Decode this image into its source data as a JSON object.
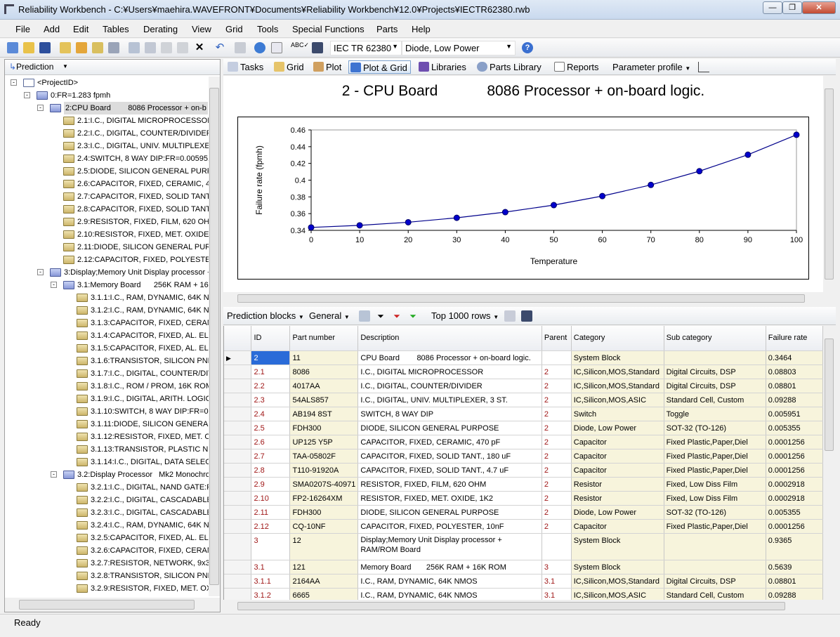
{
  "window": {
    "title": "Reliability Workbench - C:¥Users¥maehira.WAVEFRONT¥Documents¥Reliability Workbench¥12.0¥Projects¥IECTR62380.rwb"
  },
  "menu": [
    "File",
    "Add",
    "Edit",
    "Tables",
    "Derating",
    "View",
    "Grid",
    "Tools",
    "Special Functions",
    "Parts",
    "Help"
  ],
  "toolbar": {
    "standard_combo": "IEC TR 62380",
    "category_combo": "Diode, Low Power"
  },
  "left_header": "Prediction",
  "tree": [
    {
      "label": "<ProjectID>",
      "depth": 0,
      "exp": "-",
      "icon": "doc"
    },
    {
      "label": "0:FR=1.283 fpmh",
      "depth": 1,
      "exp": "-",
      "icon": "blue"
    },
    {
      "label": "2:CPU Board        8086 Processor + on-b",
      "depth": 2,
      "exp": "-",
      "icon": "blue",
      "hl": true
    },
    {
      "label": "2.1:I.C., DIGITAL MICROPROCESSOR:F",
      "depth": 3,
      "icon": "y"
    },
    {
      "label": "2.2:I.C., DIGITAL, COUNTER/DIVIDER:F",
      "depth": 3,
      "icon": "y"
    },
    {
      "label": "2.3:I.C., DIGITAL, UNIV. MULTIPLEXER, ",
      "depth": 3,
      "icon": "y"
    },
    {
      "label": "2.4:SWITCH, 8 WAY DIP:FR=0.005951",
      "depth": 3,
      "icon": "y"
    },
    {
      "label": "2.5:DIODE, SILICON GENERAL PURPOS",
      "depth": 3,
      "icon": "y"
    },
    {
      "label": "2.6:CAPACITOR, FIXED, CERAMIC, 470",
      "depth": 3,
      "icon": "y"
    },
    {
      "label": "2.7:CAPACITOR, FIXED, SOLID TANT., ",
      "depth": 3,
      "icon": "y"
    },
    {
      "label": "2.8:CAPACITOR, FIXED, SOLID TANT., ",
      "depth": 3,
      "icon": "y"
    },
    {
      "label": "2.9:RESISTOR, FIXED, FILM, 620 OHM:I",
      "depth": 3,
      "icon": "y"
    },
    {
      "label": "2.10:RESISTOR, FIXED, MET. OXIDE, 1I",
      "depth": 3,
      "icon": "y"
    },
    {
      "label": "2.11:DIODE, SILICON GENERAL PURPO",
      "depth": 3,
      "icon": "y"
    },
    {
      "label": "2.12:CAPACITOR, FIXED, POLYESTER, ",
      "depth": 3,
      "icon": "y"
    },
    {
      "label": "3:Display;Memory Unit Display processor +",
      "depth": 2,
      "exp": "-",
      "icon": "blue"
    },
    {
      "label": "3.1:Memory Board      256K RAM + 16",
      "depth": 3,
      "exp": "-",
      "icon": "blue"
    },
    {
      "label": "3.1.1:I.C., RAM, DYNAMIC, 64K NM",
      "depth": 4,
      "icon": "y"
    },
    {
      "label": "3.1.2:I.C., RAM, DYNAMIC, 64K NM",
      "depth": 4,
      "icon": "y"
    },
    {
      "label": "3.1.3:CAPACITOR, FIXED, CERAMI",
      "depth": 4,
      "icon": "y"
    },
    {
      "label": "3.1.4:CAPACITOR, FIXED, AL. ELE",
      "depth": 4,
      "icon": "y"
    },
    {
      "label": "3.1.5:CAPACITOR, FIXED, AL. ELE",
      "depth": 4,
      "icon": "y"
    },
    {
      "label": "3.1.6:TRANSISTOR, SILICON PNP:F",
      "depth": 4,
      "icon": "y"
    },
    {
      "label": "3.1.7:I.C., DIGITAL, COUNTER/DIVI",
      "depth": 4,
      "icon": "y"
    },
    {
      "label": "3.1.8:I.C., ROM / PROM, 16K ROM:F",
      "depth": 4,
      "icon": "y"
    },
    {
      "label": "3.1.9:I.C., DIGITAL, ARITH. LOGIC/",
      "depth": 4,
      "icon": "y"
    },
    {
      "label": "3.1.10:SWITCH, 8 WAY DIP:FR=0.0",
      "depth": 4,
      "icon": "y"
    },
    {
      "label": "3.1.11:DIODE, SILICON GENERAL F",
      "depth": 4,
      "icon": "y"
    },
    {
      "label": "3.1.12:RESISTOR, FIXED, MET. OXI",
      "depth": 4,
      "icon": "y"
    },
    {
      "label": "3.1.13:TRANSISTOR, PLASTIC NPN",
      "depth": 4,
      "icon": "y"
    },
    {
      "label": "3.1.14:I.C., DIGITAL, DATA SELECT",
      "depth": 4,
      "icon": "y"
    },
    {
      "label": "3.2:Display Processor   Mk2 Monochro",
      "depth": 3,
      "exp": "-",
      "icon": "blue"
    },
    {
      "label": "3.2.1:I.C., DIGITAL, NAND GATE:FF",
      "depth": 4,
      "icon": "y"
    },
    {
      "label": "3.2.2:I.C., DIGITAL, CASCADABLE",
      "depth": 4,
      "icon": "y"
    },
    {
      "label": "3.2.3:I.C., DIGITAL, CASCADABLE",
      "depth": 4,
      "icon": "y"
    },
    {
      "label": "3.2.4:I.C., RAM, DYNAMIC, 64K NM",
      "depth": 4,
      "icon": "y"
    },
    {
      "label": "3.2.5:CAPACITOR, FIXED, AL. ELE",
      "depth": 4,
      "icon": "y"
    },
    {
      "label": "3.2.6:CAPACITOR, FIXED, CERAMI",
      "depth": 4,
      "icon": "y"
    },
    {
      "label": "3.2.7:RESISTOR, NETWORK, 9x33(",
      "depth": 4,
      "icon": "y"
    },
    {
      "label": "3.2.8:TRANSISTOR, SILICON PNP:F",
      "depth": 4,
      "icon": "y"
    },
    {
      "label": "3.2.9:RESISTOR, FIXED, MET. OXID",
      "depth": 4,
      "icon": "y"
    }
  ],
  "tabs": [
    "Tasks",
    "Grid",
    "Plot",
    "Plot & Grid",
    "Libraries",
    "Parts Library",
    "Reports",
    "Parameter profile"
  ],
  "chart_title": "2 - CPU Board            8086 Processor + on-board logic.",
  "chart_data": {
    "type": "line",
    "x": [
      0,
      10,
      20,
      30,
      40,
      50,
      60,
      70,
      80,
      90,
      100
    ],
    "series": [
      {
        "values": [
          0.3435,
          0.346,
          0.3497,
          0.355,
          0.3618,
          0.3702,
          0.381,
          0.3943,
          0.4107,
          0.4304,
          0.4542
        ]
      }
    ],
    "xlabel": "Temperature",
    "ylabel": "Failure rate (fpmh)",
    "xlim": [
      0,
      100
    ],
    "ylim": [
      0.34,
      0.46
    ],
    "xticks": [
      0,
      10,
      20,
      30,
      40,
      50,
      60,
      70,
      80,
      90,
      100
    ],
    "yticks": [
      0.34,
      0.36,
      0.38,
      0.4,
      0.42,
      0.44,
      0.46
    ],
    "ytick_labels": [
      "0.34",
      "0.36",
      "0.38",
      "0.4",
      "0.42",
      "0.44",
      "0.46"
    ],
    "line_color": "#00008b",
    "marker_color": "#0000cc"
  },
  "grid_toolbar": {
    "blocks": "Prediction blocks",
    "view": "General",
    "rows": "Top 1000 rows"
  },
  "columns": [
    "ID",
    "Part number",
    "Description",
    "Parent",
    "Category",
    "Sub category",
    "Failure rate"
  ],
  "rows": [
    [
      "2",
      "11",
      "CPU Board        8086 Processor + on-board logic.",
      "",
      "System Block",
      "",
      "0.3464"
    ],
    [
      "2.1",
      "8086",
      "I.C., DIGITAL MICROPROCESSOR",
      "2",
      "IC,Silicon,MOS,Standard",
      "Digital Circuits, DSP",
      "0.08803"
    ],
    [
      "2.2",
      "4017AA",
      "I.C., DIGITAL, COUNTER/DIVIDER",
      "2",
      "IC,Silicon,MOS,Standard",
      "Digital Circuits, DSP",
      "0.08801"
    ],
    [
      "2.3",
      "54ALS857",
      "I.C., DIGITAL, UNIV. MULTIPLEXER, 3 ST.",
      "2",
      "IC,Silicon,MOS,ASIC",
      "Standard Cell, Custom",
      "0.09288"
    ],
    [
      "2.4",
      "AB194 8ST",
      "SWITCH, 8 WAY DIP",
      "2",
      "Switch",
      "Toggle",
      "0.005951"
    ],
    [
      "2.5",
      "FDH300",
      "DIODE, SILICON GENERAL PURPOSE",
      "2",
      "Diode, Low Power",
      "SOT-32 (TO-126)",
      "0.005355"
    ],
    [
      "2.6",
      "UP125 Y5P",
      "CAPACITOR, FIXED, CERAMIC, 470 pF",
      "2",
      "Capacitor",
      "Fixed Plastic,Paper,Diel",
      "0.0001256"
    ],
    [
      "2.7",
      "TAA-05802F",
      "CAPACITOR, FIXED, SOLID TANT., 180 uF",
      "2",
      "Capacitor",
      "Fixed Plastic,Paper,Diel",
      "0.0001256"
    ],
    [
      "2.8",
      "T110-91920A",
      "CAPACITOR, FIXED, SOLID TANT., 4.7 uF",
      "2",
      "Capacitor",
      "Fixed Plastic,Paper,Diel",
      "0.0001256"
    ],
    [
      "2.9",
      "SMA0207S-40971",
      "RESISTOR, FIXED, FILM, 620 OHM",
      "2",
      "Resistor",
      "Fixed, Low Diss Film",
      "0.0002918"
    ],
    [
      "2.10",
      "FP2-16264XM",
      "RESISTOR, FIXED, MET. OXIDE, 1K2",
      "2",
      "Resistor",
      "Fixed, Low Diss Film",
      "0.0002918"
    ],
    [
      "2.11",
      "FDH300",
      "DIODE, SILICON GENERAL PURPOSE",
      "2",
      "Diode, Low Power",
      "SOT-32 (TO-126)",
      "0.005355"
    ],
    [
      "2.12",
      "CQ-10NF",
      "CAPACITOR, FIXED, POLYESTER, 10nF",
      "2",
      "Capacitor",
      "Fixed Plastic,Paper,Diel",
      "0.0001256"
    ],
    [
      "3",
      "12",
      "Display;Memory Unit Display processor + RAM/ROM Board",
      "",
      "System Block",
      "",
      "0.9365"
    ],
    [
      "3.1",
      "121",
      "Memory Board       256K RAM + 16K ROM",
      "3",
      "System Block",
      "",
      "0.5639"
    ],
    [
      "3.1.1",
      "2164AA",
      "I.C., RAM, DYNAMIC, 64K NMOS",
      "3.1",
      "IC,Silicon,MOS,Standard",
      "Digital Circuits, DSP",
      "0.08801"
    ],
    [
      "3.1.2",
      "6665",
      "I.C., RAM, DYNAMIC, 64K NMOS",
      "3.1",
      "IC,Silicon,MOS,ASIC",
      "Standard Cell, Custom",
      "0.09288"
    ]
  ],
  "status": "Ready"
}
